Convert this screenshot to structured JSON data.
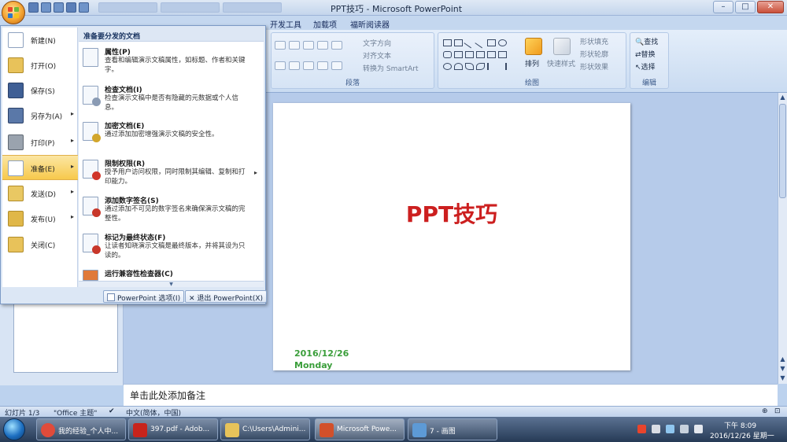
{
  "window": {
    "title": "PPT技巧 - Microsoft PowerPoint",
    "controls": {
      "minimize": "–",
      "maximize": "□",
      "close": "✕"
    }
  },
  "ribbon": {
    "tabs": [
      "开发工具",
      "加载项",
      "福昕阅读器"
    ],
    "paragraph": {
      "label": "段落",
      "text_direction": "文字方向",
      "align_text": "对齐文本",
      "convert_smartart": "转换为 SmartArt"
    },
    "drawing": {
      "label": "绘图",
      "arrange": "排列",
      "quick_styles": "快速样式",
      "shape_fill": "形状填充",
      "shape_outline": "形状轮廓",
      "shape_effects": "形状效果"
    },
    "editing": {
      "label": "编辑",
      "find": "查找",
      "replace": "替换",
      "select": "选择"
    }
  },
  "office_menu": {
    "left_items": [
      {
        "label": "新建(N)",
        "icon": "new-document-icon",
        "arrow": ""
      },
      {
        "label": "打开(O)",
        "icon": "open-folder-icon",
        "arrow": ""
      },
      {
        "label": "保存(S)",
        "icon": "save-disk-icon",
        "arrow": ""
      },
      {
        "label": "另存为(A)",
        "icon": "save-as-icon",
        "arrow": "▸"
      },
      {
        "label": "打印(P)",
        "icon": "printer-icon",
        "arrow": "▸"
      },
      {
        "label": "准备(E)",
        "icon": "prepare-icon",
        "arrow": "▸"
      },
      {
        "label": "发送(D)",
        "icon": "send-icon",
        "arrow": "▸"
      },
      {
        "label": "发布(U)",
        "icon": "publish-icon",
        "arrow": "▸"
      },
      {
        "label": "关闭(C)",
        "icon": "close-folder-icon",
        "arrow": ""
      }
    ],
    "right_header": "准备要分发的文档",
    "entries": [
      {
        "title": "属性(P)",
        "desc": "查看和编辑演示文稿属性，如标题、作者和关键字。",
        "arrow": ""
      },
      {
        "title": "检查文档(I)",
        "desc": "检查演示文稿中是否有隐藏的元数据或个人信息。",
        "arrow": ""
      },
      {
        "title": "加密文档(E)",
        "desc": "通过添加加密增强演示文稿的安全性。",
        "arrow": ""
      },
      {
        "title": "限制权限(R)",
        "desc": "授予用户访问权限，同时限制其编辑、复制和打印能力。",
        "arrow": "▸"
      },
      {
        "title": "添加数字签名(S)",
        "desc": "通过添加不可见的数字签名来确保演示文稿的完整性。",
        "arrow": ""
      },
      {
        "title": "标记为最终状态(F)",
        "desc": "让读者知晓演示文稿是最终版本，并将其设为只读的。",
        "arrow": ""
      },
      {
        "title": "运行兼容性检查器(C)",
        "desc": "",
        "arrow": ""
      }
    ],
    "footer": {
      "options_button": "PowerPoint 选项(I)",
      "exit_button": "退出 PowerPoint(X)"
    }
  },
  "slide": {
    "title": "PPT技巧",
    "date": "2016/12/26",
    "day": "Monday"
  },
  "notes_placeholder": "单击此处添加备注",
  "statusbar": {
    "slide_count": "幻灯片 1/3",
    "theme": "\"Office 主题\"",
    "language": "中文(简体，中国)"
  },
  "taskbar": {
    "buttons": [
      {
        "label": "我的经验_个人中...",
        "icon": "chrome-icon",
        "color": "#e04b3a",
        "active": false
      },
      {
        "label": "397.pdf - Adob...",
        "icon": "pdf-icon",
        "color": "#c8241c",
        "active": false
      },
      {
        "label": "C:\\Users\\Admini...",
        "icon": "folder-icon",
        "color": "#e7c35a",
        "active": false
      },
      {
        "label": "Microsoft Powe...",
        "icon": "powerpoint-icon",
        "color": "#d2502a",
        "active": true
      },
      {
        "label": "7 - 画图",
        "icon": "paint-icon",
        "color": "#5d9ad6",
        "active": false
      }
    ],
    "clock_label": "下午 8:09",
    "date_label": "2016/12/26 星期一"
  }
}
